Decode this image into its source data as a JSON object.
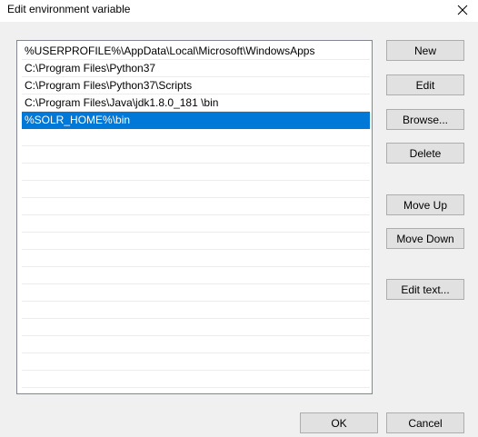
{
  "window": {
    "title": "Edit environment variable",
    "close_icon": "close-icon"
  },
  "list": {
    "items": [
      "%USERPROFILE%\\AppData\\Local\\Microsoft\\WindowsApps",
      "C:\\Program Files\\Python37",
      "C:\\Program Files\\Python37\\Scripts",
      "C:\\Program Files\\Java\\jdk1.8.0_181 \\bin",
      "%SOLR_HOME%\\bin"
    ],
    "selected_index": 4,
    "empty_row_count": 15
  },
  "buttons": {
    "new": "New",
    "edit": "Edit",
    "browse": "Browse...",
    "delete": "Delete",
    "move_up": "Move Up",
    "move_down": "Move Down",
    "edit_text": "Edit text...",
    "ok": "OK",
    "cancel": "Cancel"
  },
  "colors": {
    "selection": "#0078d7",
    "dialog_background": "#f0f0f0",
    "button_face": "#e1e1e1",
    "button_border": "#adadad"
  }
}
